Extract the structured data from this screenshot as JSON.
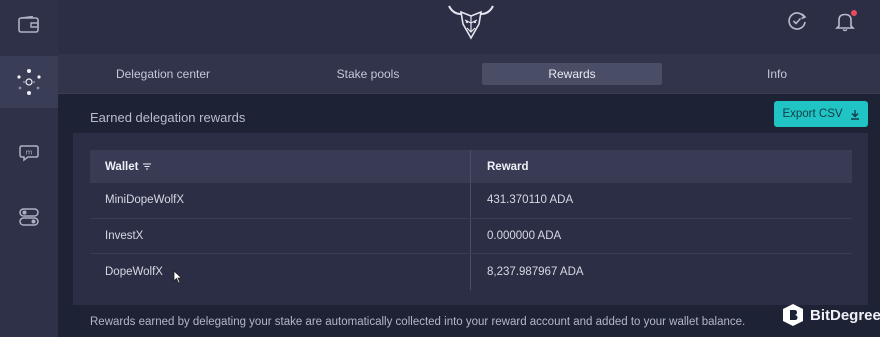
{
  "sidebar": {
    "items": [
      {
        "icon": "wallet-icon"
      },
      {
        "icon": "staking-icon",
        "active": true
      },
      {
        "icon": "mx-chat-icon"
      },
      {
        "icon": "toggles-icon"
      }
    ]
  },
  "topbar": {
    "logo": "bull-logo",
    "sync_icon": "sync-check-icon",
    "notification_icon": "bell-icon"
  },
  "tabs": [
    {
      "label": "Delegation center"
    },
    {
      "label": "Stake pools"
    },
    {
      "label": "Rewards",
      "active": true
    },
    {
      "label": "Info"
    }
  ],
  "main": {
    "title": "Earned delegation rewards",
    "export_label": "Export CSV",
    "table": {
      "headers": [
        "Wallet",
        "Reward"
      ],
      "rows": [
        {
          "wallet": "MiniDopeWolfX",
          "reward": "431.370110 ADA"
        },
        {
          "wallet": "InvestX",
          "reward": "0.000000 ADA"
        },
        {
          "wallet": "DopeWolfX",
          "reward": "8,237.987967 ADA"
        }
      ]
    },
    "note": "Rewards earned by delegating your stake are automatically collected into your reward account and added to your wallet balance."
  },
  "brand": {
    "name": "BitDegree"
  },
  "colors": {
    "accent": "#20c4c4",
    "background": "#1e2235",
    "notification": "#ea4c5f"
  }
}
